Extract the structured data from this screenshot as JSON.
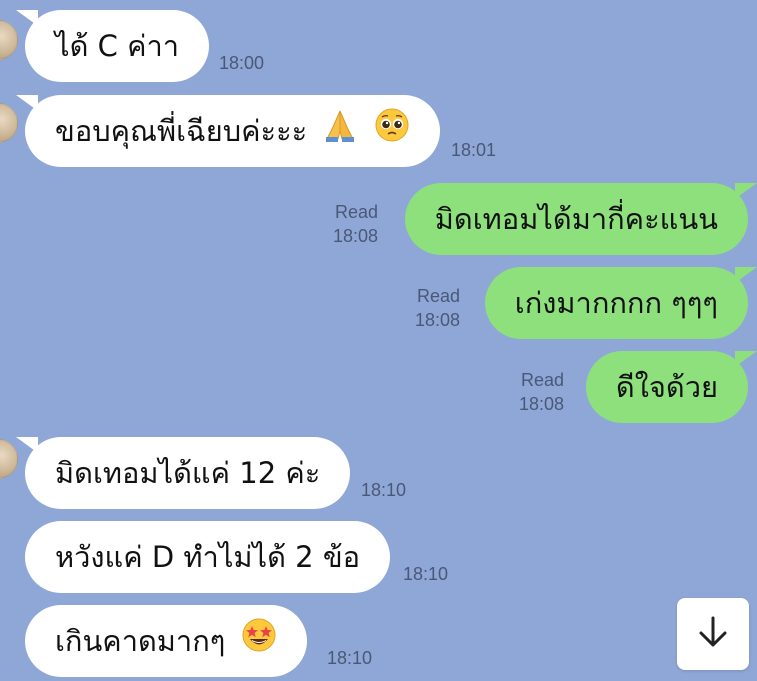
{
  "messages": [
    {
      "id": "m1",
      "text": "ได้ C ค่าา",
      "time": "18:00"
    },
    {
      "id": "m2",
      "text": "ขอบคุณพี่เฉียบค่ะะะ",
      "emojis": [
        "folded-hands-icon",
        "pleading-face-icon"
      ],
      "time": "18:01"
    },
    {
      "id": "m3",
      "text": "มิดเทอมได้มากี่คะแนน",
      "read": "Read",
      "time": "18:08"
    },
    {
      "id": "m4",
      "text": "เก่งมากกกก ๆๆๆ",
      "read": "Read",
      "time": "18:08"
    },
    {
      "id": "m5",
      "text": "ดีใจด้วย",
      "read": "Read",
      "time": "18:08"
    },
    {
      "id": "m6",
      "text": "มิดเทอมได้แค่ 12 ค่ะ",
      "time": "18:10"
    },
    {
      "id": "m7",
      "text": "หวังแค่ D ทำไม่ได้ 2 ข้อ",
      "time": "18:10"
    },
    {
      "id": "m8",
      "text": "เกินคาดมากๆ",
      "emojis": [
        "star-struck-face-icon"
      ],
      "time": "18:10"
    }
  ],
  "colors": {
    "background": "#8fa7d6",
    "incoming": "#ffffff",
    "outgoing": "#8de07c"
  },
  "controls": {
    "scroll_down_icon": "arrow-down-icon"
  }
}
